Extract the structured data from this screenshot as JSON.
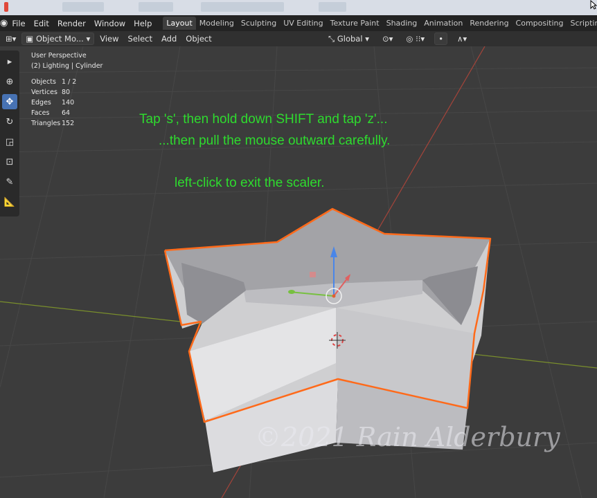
{
  "menubar": {
    "logo_icon": "blender-logo-icon",
    "menus": [
      "File",
      "Edit",
      "Render",
      "Window",
      "Help"
    ],
    "tabs": [
      "Layout",
      "Modeling",
      "Sculpting",
      "UV Editing",
      "Texture Paint",
      "Shading",
      "Animation",
      "Rendering",
      "Compositing",
      "Scripting"
    ],
    "active_tab": "Layout",
    "add_tab": "+"
  },
  "header": {
    "mode": "Object Mo...",
    "view": "View",
    "select": "Select",
    "add": "Add",
    "object": "Object",
    "orientation": "Global"
  },
  "stats": {
    "perspective": "User Perspective",
    "collection": "(2) Lighting | Cylinder",
    "rows": [
      {
        "k": "Objects",
        "v": "1 / 2"
      },
      {
        "k": "Vertices",
        "v": "80"
      },
      {
        "k": "Edges",
        "v": "140"
      },
      {
        "k": "Faces",
        "v": "64"
      },
      {
        "k": "Triangles",
        "v": "152"
      }
    ]
  },
  "instructions": {
    "line1": "Tap 's', then hold down SHIFT and tap 'z'...",
    "line2": "...then pull the mouse outward carefully.",
    "line3": "left-click to exit the scaler."
  },
  "watermark": "©2021 Rain Alderbury",
  "colors": {
    "selection_outline": "#ff6a1a",
    "instruction_text": "#2edb2e",
    "active_tool": "#4772b3",
    "x_axis": "#b0453a",
    "y_axis": "#8aa82a"
  },
  "tools": [
    "select-box-icon",
    "cursor-icon",
    "move-icon",
    "rotate-icon",
    "scale-icon",
    "transform-icon",
    "annotate-icon",
    "measure-icon"
  ]
}
